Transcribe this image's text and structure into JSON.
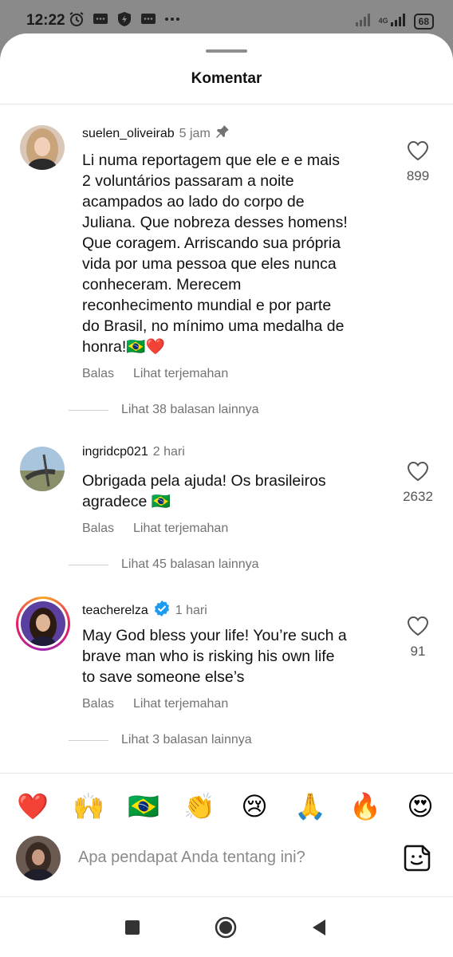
{
  "status_bar": {
    "time": "12:22",
    "network": "4G",
    "battery": "68"
  },
  "sheet": {
    "title": "Komentar"
  },
  "comments": [
    {
      "username": "suelen_oliveirab",
      "time": "5 jam",
      "pinned": true,
      "verified": false,
      "text_lines": [
        "Li numa reportagem que ele e e mais",
        "2 voluntários passaram a noite",
        "acampados ao lado do corpo de",
        "Juliana. Que nobreza desses homens!",
        "Que coragem. Arriscando sua própria",
        "vida por uma pessoa que eles nunca",
        "conheceram.  Merecem",
        "reconhecimento mundial e por parte",
        "do Brasil, no mínimo uma medalha de",
        "honra!🇧🇷❤️"
      ],
      "likes": "899",
      "reply_label": "Balas",
      "translate_label": "Lihat terjemahan",
      "more_replies": "Lihat 38 balasan lainnya"
    },
    {
      "username": "ingridcp021",
      "time": "2 hari",
      "pinned": false,
      "verified": false,
      "text_lines": [
        "Obrigada pela ajuda! Os brasileiros",
        "agradece 🇧🇷"
      ],
      "likes": "2632",
      "reply_label": "Balas",
      "translate_label": "Lihat terjemahan",
      "more_replies": "Lihat 45 balasan lainnya"
    },
    {
      "username": "teacherelza",
      "time": "1 hari",
      "pinned": false,
      "verified": true,
      "text_lines": [
        "May God bless your life! You’re such a",
        "brave man who is risking his own life",
        "to save someone else’s"
      ],
      "likes": "91",
      "reply_label": "Balas",
      "translate_label": "Lihat terjemahan",
      "more_replies": "Lihat 3 balasan lainnya"
    }
  ],
  "quick_reactions": [
    "❤️",
    "🙌",
    "🇧🇷",
    "👏",
    "😢",
    "🙏",
    "🔥",
    "😍"
  ],
  "composer": {
    "placeholder": "Apa pendapat Anda tentang ini?"
  },
  "colors": {
    "verified_blue": "#1d9bf0",
    "muted_text": "#737373",
    "story_ring": [
      "#f9a825",
      "#e91e63",
      "#9c27b0"
    ]
  }
}
